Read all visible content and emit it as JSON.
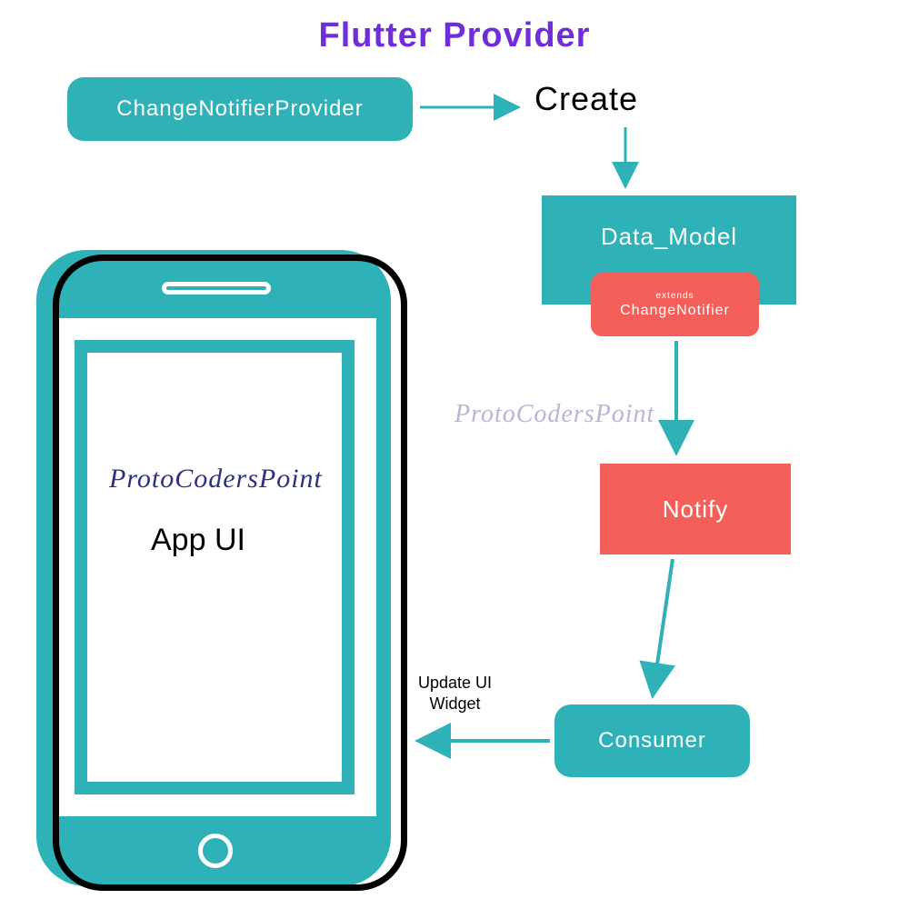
{
  "title": "Flutter Provider",
  "boxes": {
    "cnp": "ChangeNotifierProvider",
    "create": "Create",
    "datamodel": "Data_Model",
    "extends_small": "extends",
    "extends_main": "ChangeNotifier",
    "notify": "Notify",
    "consumer": "Consumer"
  },
  "labels": {
    "update_ui_1": "Update UI",
    "update_ui_2": "Widget",
    "app_ui": "App UI"
  },
  "watermark": "ProtoCodersPoint",
  "colors": {
    "teal": "#2eb1b7",
    "red": "#f46059",
    "purple": "#6f2ed8"
  }
}
